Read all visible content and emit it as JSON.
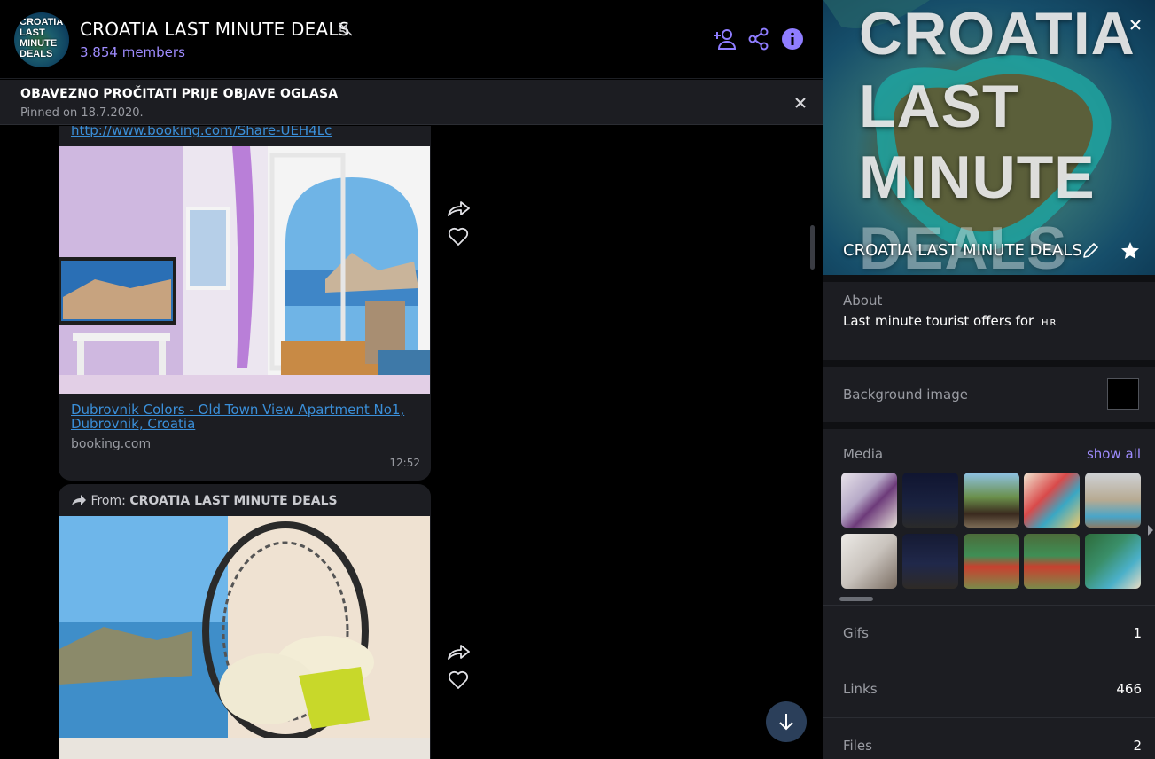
{
  "header": {
    "title": "CROATIA LAST MINUTE DEALS",
    "members": "3.854 members",
    "avatar_text": [
      "CROATIA",
      "LAST",
      "MINUTE",
      "DEALS"
    ],
    "icons": {
      "mute": "muted-speaker-icon",
      "add": "add-member-icon",
      "share": "share-icon",
      "info": "info-icon"
    }
  },
  "pinned": {
    "title": "OBAVEZNO PROČITATI PRIJE OBJAVE OGLASA",
    "date": "Pinned on 18.7.2020."
  },
  "messages": [
    {
      "url_text": "http://www.booking.com/Share-UEH4Lc",
      "link_title": "Dubrovnik Colors - Old Town View Apartment No1, Dubrovnik, Croatia",
      "domain": "booking.com",
      "time": "12:52"
    },
    {
      "from_label": "From:",
      "from_name": "CROATIA LAST MINUTE DEALS"
    }
  ],
  "panel": {
    "cover_title_lines": [
      "CROATIA",
      "LAST",
      "MINUTE",
      "DEALS"
    ],
    "name": "CROATIA LAST MINUTE DEALS",
    "about_label": "About",
    "about_text": "Last minute tourist offers for",
    "about_flag": "HR",
    "background_label": "Background image",
    "media_label": "Media",
    "show_all": "show all",
    "gifs_label": "Gifs",
    "gifs_count": "1",
    "links_label": "Links",
    "links_count": "466",
    "files_label": "Files",
    "files_count": "2"
  },
  "colors": {
    "accent": "#9f8cff",
    "link": "#3a8fd9",
    "panel_bg": "#1c1d22",
    "chat_bg": "#000000"
  }
}
